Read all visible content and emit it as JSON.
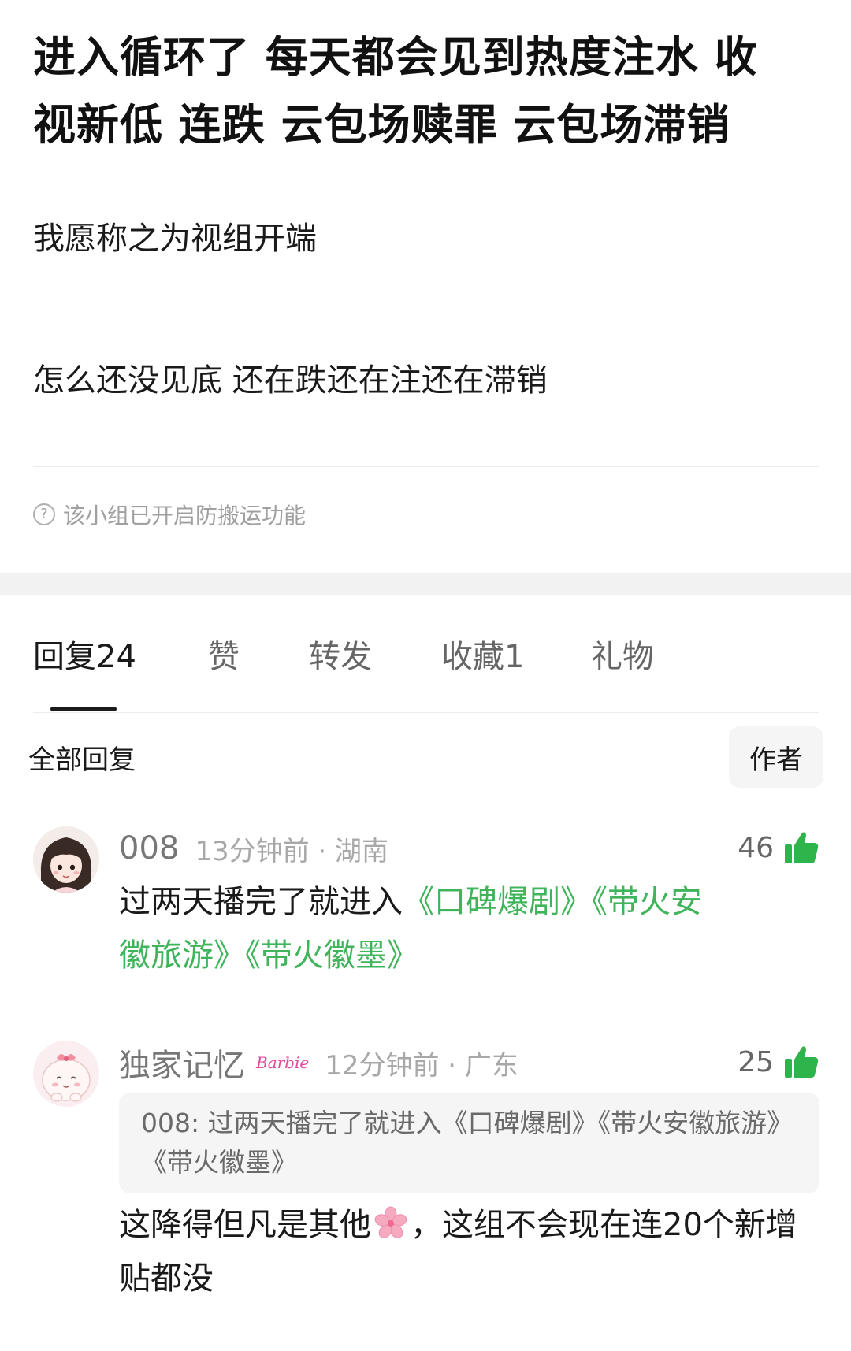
{
  "post": {
    "title_line_1": "进入循环了 每天都会见到热度注水 收",
    "title_line_2": "视新低 连跌 云包场赎罪 云包场滞销",
    "paragraph_1": "我愿称之为视组开端",
    "paragraph_2": "怎么还没见底 还在跌还在注还在滞销",
    "notice": "该小组已开启防搬运功能",
    "notice_icon": "?"
  },
  "tabs": [
    {
      "label": "回复24",
      "active": true
    },
    {
      "label": "赞",
      "active": false
    },
    {
      "label": "转发",
      "active": false
    },
    {
      "label": "收藏1",
      "active": false
    },
    {
      "label": "礼物",
      "active": false
    }
  ],
  "replies": {
    "filter_title": "全部回复",
    "author_filter": "作者"
  },
  "comments": [
    {
      "username": "008",
      "time_location": "13分钟前 · 湖南",
      "likes": "46",
      "text_prefix": "过两天播完了就进入",
      "tags_line_1": "《口碑爆剧》《带火安",
      "tags_line_2": "徽旅游》《带火徽墨》"
    },
    {
      "username": "独家记忆",
      "badge": "Barbie",
      "time_location": "12分钟前 · 广东",
      "likes": "25",
      "quote": "008: 过两天播完了就进入《口碑爆剧》《带火安徽旅游》《带火徽墨》",
      "text_before_emoji": "这降得但凡是其他",
      "text_after_emoji": "，这组不会现在连20个新增贴都没"
    }
  ],
  "colors": {
    "tag_green": "#3fb45a",
    "thumb_green": "#2db44a",
    "badge_pink": "#e0489a",
    "band_gray": "#f2f2f2"
  },
  "icons": {
    "thumb": "thumbs-up-icon",
    "notice": "question-circle-icon",
    "flower": "cherry-blossom-emoji"
  }
}
